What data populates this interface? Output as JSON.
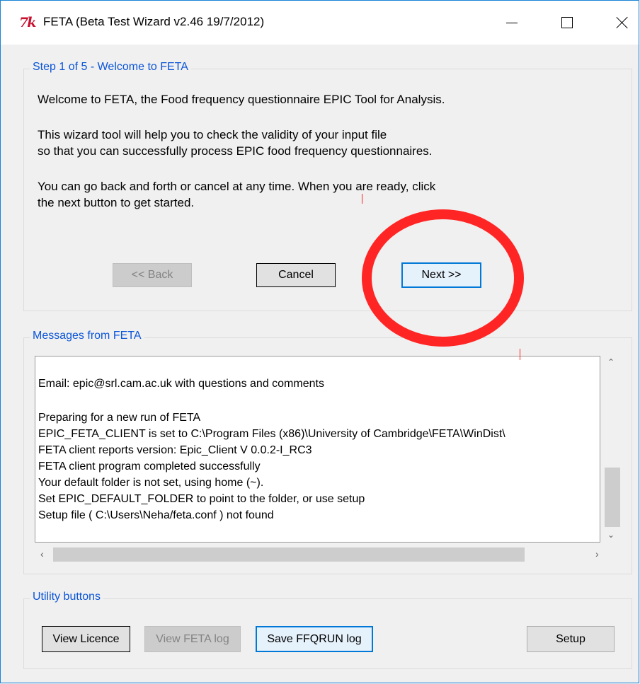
{
  "window": {
    "app_icon_text": "7k",
    "title": "FETA (Beta Test Wizard v2.46 19/7/2012)"
  },
  "step_panel": {
    "legend": "Step 1 of 5 - Welcome to FETA",
    "paragraphs": [
      "Welcome to FETA, the Food frequency questionnaire EPIC Tool for Analysis.",
      "This wizard tool will help you to check the validity of your input file",
      "so that you can successfully process EPIC food frequency questionnaires.",
      "You can go back and forth or cancel at any time. When you are ready, click",
      "the next button to get started."
    ],
    "buttons": {
      "back": "<< Back",
      "cancel": "Cancel",
      "next": "Next >>"
    }
  },
  "messages_panel": {
    "legend": "Messages from FETA",
    "lines": [
      "Email: epic@srl.cam.ac.uk with questions and comments",
      "",
      "Preparing for a new run of FETA",
      "EPIC_FETA_CLIENT is set to C:\\Program Files (x86)\\University of Cambridge\\FETA\\WinDist\\",
      "FETA client reports version: Epic_Client V 0.0.2-I_RC3",
      "FETA client program completed successfully",
      "Your default folder is not set, using home (~).",
      "Set EPIC_DEFAULT_FOLDER to point to the folder, or use setup",
      "Setup file ( C:\\Users\\Neha/feta.conf ) not found"
    ]
  },
  "utility_panel": {
    "legend": "Utility buttons",
    "buttons": {
      "view_licence": "View Licence",
      "view_feta_log": "View FETA log",
      "save_ffqrun_log": "Save FFQRUN log",
      "setup": "Setup"
    }
  },
  "annotation": {
    "color": "#ff2525"
  }
}
